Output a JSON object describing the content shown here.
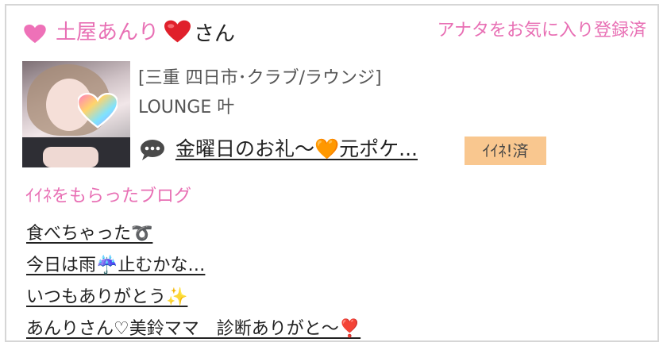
{
  "profile": {
    "name": "土屋あんり",
    "suffix": "さん",
    "favorite_status": "アナタをお気に入り登録済",
    "location": "[三重 四日市･クラブ/ラウンジ]",
    "shop": "LOUNGE 叶",
    "latest_post": "金曜日のお礼～🧡元ポケ...",
    "like_badge": "ｲｲﾈ!済"
  },
  "liked_blogs": {
    "title": "ｲｲﾈをもらったブログ",
    "items": [
      "食べちゃった➰",
      "今日は雨☔️止むかな…",
      "いつもありがとう✨",
      "あんりさん♡美鈴ママ　診断ありがと～❣️"
    ]
  },
  "colors": {
    "accent_pink": "#e86fb4",
    "heart_red": "#e0202b",
    "badge_orange": "#f9c78f"
  },
  "icons": {
    "pink_heart": "heart-icon",
    "red_heart": "red-heart-icon",
    "chat": "chat-bubble-icon"
  }
}
